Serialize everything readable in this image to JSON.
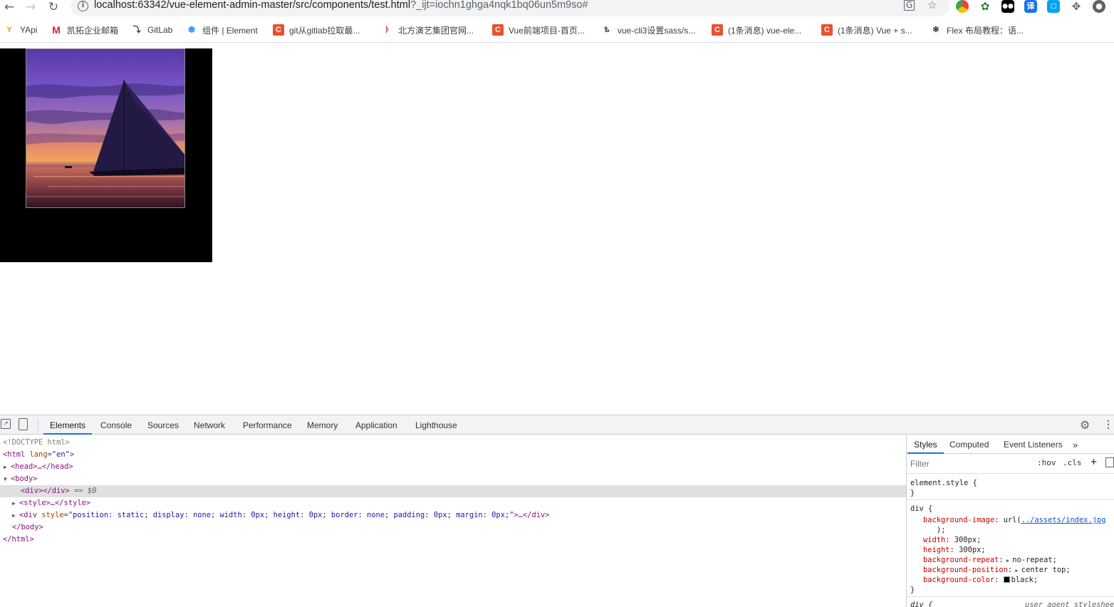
{
  "browser": {
    "url_main": "localhost:63342/vue-element-admin-master/src/components/test.html",
    "url_query": "?_ijt=iochn1ghga4nqk1bq06un5m9so#",
    "bookmarks": [
      {
        "label": "YApi",
        "icon": "yapi-icon"
      },
      {
        "label": "凯拓企业邮箱",
        "icon": "mail-icon"
      },
      {
        "label": "GitLab",
        "icon": "gitlab-icon"
      },
      {
        "label": "组件 | Element",
        "icon": "element-icon"
      },
      {
        "label": "git从gitlab拉取最...",
        "icon": "csdn-icon"
      },
      {
        "label": "北方演艺集团官网...",
        "icon": "bookmark-icon"
      },
      {
        "label": "Vue前端项目-首页...",
        "icon": "csdn-icon"
      },
      {
        "label": "vue-cli3设置sass/s...",
        "icon": "vue-icon"
      },
      {
        "label": "(1条消息) vue-ele...",
        "icon": "csdn-icon"
      },
      {
        "label": "(1条消息) Vue + s...",
        "icon": "csdn-icon"
      },
      {
        "label": "Flex 布局教程：语...",
        "icon": "ruanyf-icon"
      }
    ]
  },
  "devtools": {
    "tabs": [
      "Elements",
      "Console",
      "Sources",
      "Network",
      "Performance",
      "Memory",
      "Application",
      "Lighthouse"
    ],
    "active_tab": "Elements",
    "dom": {
      "doctype": "<!DOCTYPE html>",
      "html_open": "<html",
      "html_attr": "lang",
      "html_val": "\"en\"",
      "html_close": ">",
      "head": "<head>…</head>",
      "body_open": "<body>",
      "div_selected": "<div></div>",
      "div_selected_marker": "== $0",
      "style": "<style>…</style>",
      "div2_open": "<div",
      "div2_attr": "style",
      "div2_val": "\"position: static; display: none; width: 0px; height: 0px; border: none; padding: 0px; margin: 0px;\"",
      "div2_close": ">…</div>",
      "body_close": "</body>",
      "html_end": "</html>"
    },
    "styles_tabs": [
      "Styles",
      "Computed",
      "Event Listeners"
    ],
    "filter_placeholder": "Filter",
    "hov": ":hov",
    "cls": ".cls",
    "rules": {
      "element_style": "element.style {",
      "close": "}",
      "div_selector": "div {",
      "bg_image_prop": "background-image",
      "bg_image_fn": "url(",
      "bg_image_url": "../assets/index.jpg",
      "bg_image_end": ");",
      "width_prop": "width",
      "width_val": "300px;",
      "height_prop": "height",
      "height_val": "300px;",
      "repeat_prop": "background-repeat",
      "repeat_val": "no-repeat;",
      "position_prop": "background-position",
      "position_val": "center top;",
      "color_prop": "background-color",
      "color_val": "black;",
      "ua_selector": "div {",
      "ua_label": "user agent stylesheet"
    }
  }
}
